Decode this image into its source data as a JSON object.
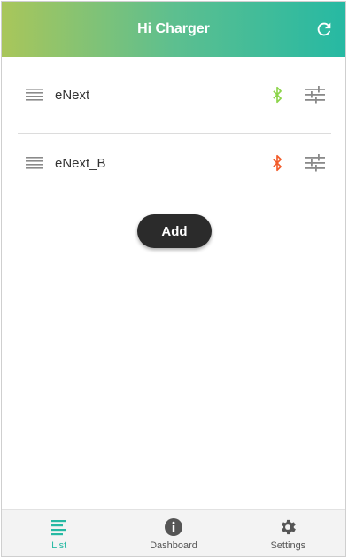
{
  "header": {
    "title": "Hi Charger",
    "refresh_icon": "refresh-icon"
  },
  "colors": {
    "accent": "#26b9a3",
    "bt_connected": "#8cd44a",
    "bt_disconnected": "#f25c2a",
    "button_dark": "#2b2b2b"
  },
  "devices": [
    {
      "name": "eNext",
      "bluetooth_icon": "bluetooth-icon",
      "bluetooth_state": "connected"
    },
    {
      "name": "eNext_B",
      "bluetooth_icon": "bluetooth-icon",
      "bluetooth_state": "disconnected"
    }
  ],
  "add_button": {
    "label": "Add"
  },
  "tabs": [
    {
      "label": "List",
      "icon": "list-icon",
      "active": true
    },
    {
      "label": "Dashboard",
      "icon": "info-icon",
      "active": false
    },
    {
      "label": "Settings",
      "icon": "gear-icon",
      "active": false
    }
  ]
}
